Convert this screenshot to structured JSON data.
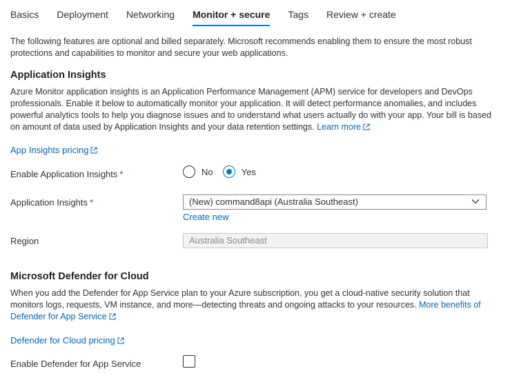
{
  "tabs": [
    {
      "label": "Basics"
    },
    {
      "label": "Deployment"
    },
    {
      "label": "Networking"
    },
    {
      "label": "Monitor + secure",
      "active": true
    },
    {
      "label": "Tags"
    },
    {
      "label": "Review + create"
    }
  ],
  "intro": "The following features are optional and billed separately. Microsoft recommends enabling them to ensure the most robust protections and capabilities to monitor and secure your web applications.",
  "app_insights": {
    "heading": "Application Insights",
    "description": "Azure Monitor application insights is an Application Performance Management (APM) service for developers and DevOps professionals. Enable it below to automatically monitor your application. It will detect performance anomalies, and includes powerful analytics tools to help you diagnose issues and to understand what users actually do with your app. Your bill is based on amount of data used by Application Insights and your data retention settings.",
    "learn_more": "Learn more",
    "pricing_link": "App Insights pricing",
    "enable_label": "Enable Application Insights",
    "option_no": "No",
    "option_yes": "Yes",
    "selected": "Yes",
    "resource_label": "Application Insights",
    "resource_value": "(New) command8api (Australia Southeast)",
    "create_new": "Create new",
    "region_label": "Region",
    "region_value": "Australia Southeast"
  },
  "defender": {
    "heading": "Microsoft Defender for Cloud",
    "description": "When you add the Defender for App Service plan to your Azure subscription, you get a cloud-native security solution that monitors logs, requests, VM instance, and more—detecting threats and ongoing attacks to your resources.",
    "more_link": "More benefits of Defender for App Service",
    "pricing_link": "Defender for Cloud pricing",
    "enable_label": "Enable Defender for App Service",
    "enabled": false
  },
  "required_mark": "*",
  "colors": {
    "accent": "#0078d4",
    "link": "#0067b8",
    "text": "#323130",
    "required": "#a4262c"
  }
}
